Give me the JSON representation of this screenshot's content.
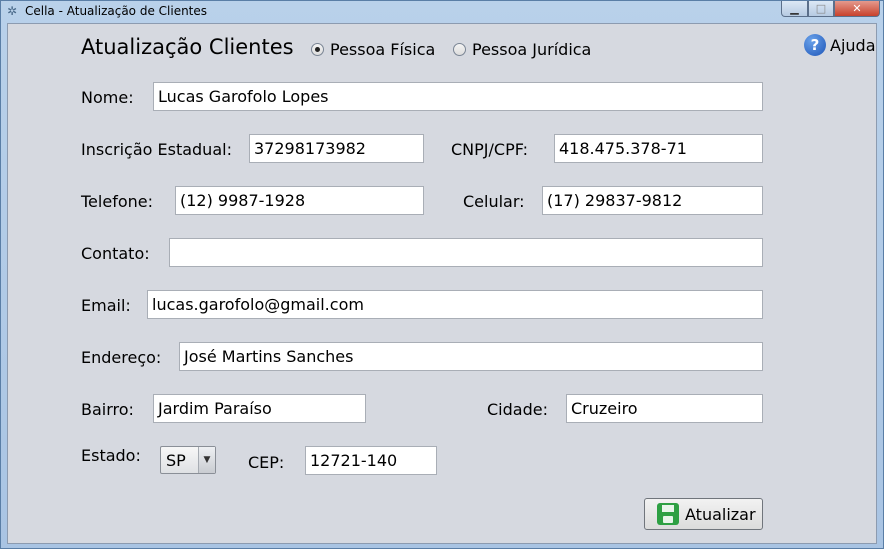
{
  "window": {
    "title": "Cella - Atualização de Clientes",
    "controls": {
      "minimize": "▁",
      "maximize": "□",
      "close": "✕"
    }
  },
  "header": {
    "title": "Atualização Clientes",
    "person_type": {
      "options": [
        {
          "label": "Pessoa Física",
          "selected": true
        },
        {
          "label": "Pessoa Jurídica",
          "selected": false
        }
      ]
    },
    "help_label": "Ajuda",
    "help_icon": "help-question-icon"
  },
  "form": {
    "nome": {
      "label": "Nome:",
      "value": "Lucas Garofolo Lopes"
    },
    "inscricao": {
      "label": "Inscrição Estadual:",
      "value": "37298173982"
    },
    "cnpj": {
      "label": "CNPJ/CPF:",
      "value": "418.475.378-71"
    },
    "telefone": {
      "label": "Telefone:",
      "value": "(12) 9987-1928"
    },
    "celular": {
      "label": "Celular:",
      "value": "(17) 29837-9812"
    },
    "contato": {
      "label": "Contato:",
      "value": ""
    },
    "email": {
      "label": "Email:",
      "value": "lucas.garofolo@gmail.com"
    },
    "endereco": {
      "label": "Endereço:",
      "value": "José Martins Sanches"
    },
    "bairro": {
      "label": "Bairro:",
      "value": "Jardim Paraíso"
    },
    "cidade": {
      "label": "Cidade:",
      "value": "Cruzeiro"
    },
    "estado": {
      "label": "Estado:",
      "value": "SP"
    },
    "cep": {
      "label": "CEP:",
      "value": "12721-140"
    }
  },
  "actions": {
    "update_label": "Atualizar",
    "update_icon": "save-disk-icon"
  },
  "colors": {
    "help_icon": "#1d55b8",
    "save_icon": "#2ea043",
    "panel_bg": "#d6d9e0"
  }
}
